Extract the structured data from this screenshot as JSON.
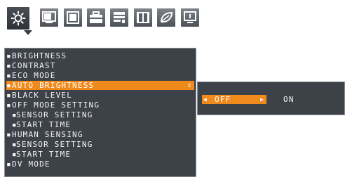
{
  "tabs": [
    {
      "icon": "sun-brightness-icon",
      "active": true
    },
    {
      "icon": "screen-size-icon",
      "active": false
    },
    {
      "icon": "window-icon",
      "active": false
    },
    {
      "icon": "toolbox-icon",
      "active": false
    },
    {
      "icon": "info-list-icon",
      "active": false
    },
    {
      "icon": "film-reel-icon",
      "active": false
    },
    {
      "icon": "eco-leaf-icon",
      "active": false
    },
    {
      "icon": "monitor-info-icon",
      "active": false
    }
  ],
  "menu": {
    "items": [
      {
        "label": "BRIGHTNESS",
        "sub": false,
        "selected": false
      },
      {
        "label": "CONTRAST",
        "sub": false,
        "selected": false
      },
      {
        "label": "ECO MODE",
        "sub": false,
        "selected": false
      },
      {
        "label": "AUTO BRIGHTNESS",
        "sub": false,
        "selected": true
      },
      {
        "label": "BLACK LEVEL",
        "sub": false,
        "selected": false
      },
      {
        "label": "OFF MODE SETTING",
        "sub": false,
        "selected": false
      },
      {
        "label": "SENSOR SETTING",
        "sub": true,
        "selected": false
      },
      {
        "label": "START TIME",
        "sub": true,
        "selected": false
      },
      {
        "label": "HUMAN SENSING",
        "sub": false,
        "selected": false
      },
      {
        "label": "SENSOR SETTING",
        "sub": true,
        "selected": false
      },
      {
        "label": "START TIME",
        "sub": true,
        "selected": false
      },
      {
        "label": "DV MODE",
        "sub": false,
        "selected": false
      }
    ],
    "updown_glyph": "⇕"
  },
  "value_panel": {
    "selected_option": "OFF",
    "other_option": "ON",
    "left_arrow": "◀",
    "right_arrow": "▶"
  },
  "colors": {
    "highlight": "#f08a1c",
    "panel_bg": "#3d4148",
    "text": "#f4f4f4"
  }
}
